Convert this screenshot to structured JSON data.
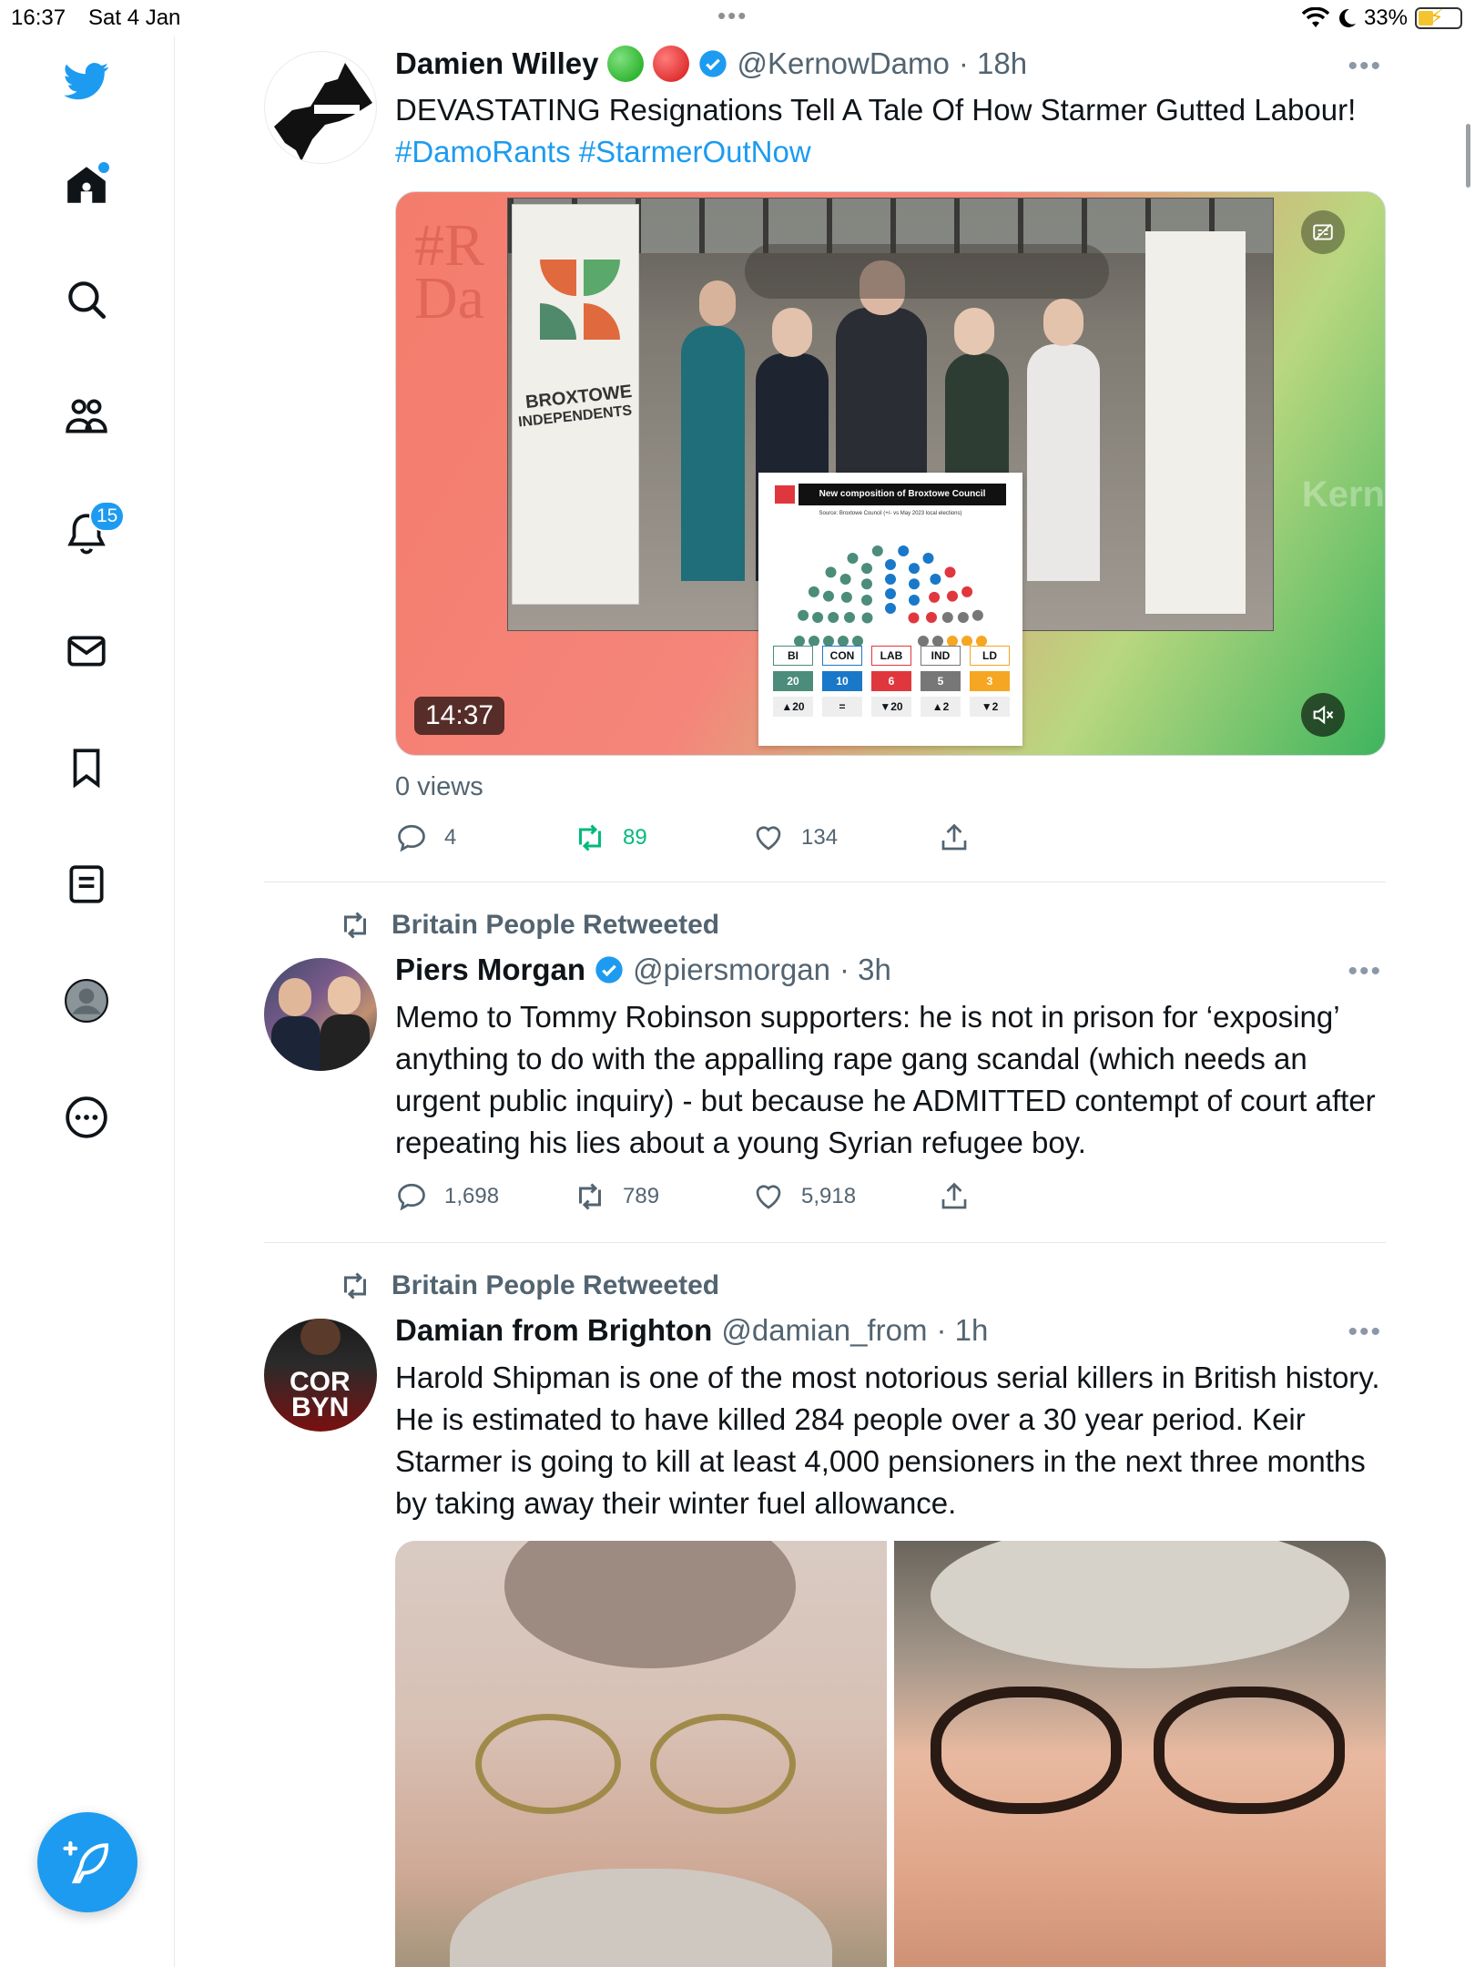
{
  "status_bar": {
    "time": "16:37",
    "date": "Sat 4 Jan",
    "battery": "33%"
  },
  "sidebar": {
    "notifications_count": "15"
  },
  "tweets": [
    {
      "name": "Damien Willey",
      "handle": "@KernowDamo",
      "time": "· 18h",
      "text_plain": "DEVASTATING Resignations Tell A Tale Of How Starmer Gutted Labour! ",
      "hashtag1": "#DamoRants",
      "hashtag2": "#StarmerOutNow",
      "video_duration": "14:37",
      "views": "0 views",
      "replies": "4",
      "retweets": "89",
      "likes": "134",
      "media": {
        "banner_line1": "BROXTOWE",
        "banner_line2": "INDEPENDENTS",
        "bg_text": "#R Da",
        "bg_text2": "Kern",
        "chart_title": "New composition of Broxtowe Council",
        "chart_source": "Source: Broxtowe Council (+/- vs May 2023 local elections)",
        "parties": [
          "BI",
          "CON",
          "LAB",
          "IND",
          "LD"
        ],
        "seats": [
          "20",
          "10",
          "6",
          "5",
          "3"
        ],
        "changes": [
          "▲20",
          "=",
          "▼20",
          "▲2",
          "▼2"
        ],
        "party_colors": [
          "#4c8c7a",
          "#1a78c8",
          "#e0373e",
          "#777777",
          "#f5a623"
        ]
      }
    },
    {
      "retweeted_by": "Britain People Retweeted",
      "name": "Piers Morgan",
      "handle": "@piersmorgan",
      "time": "· 3h",
      "text": "Memo to Tommy Robinson supporters: he is not in prison for ‘exposing’ anything to do with the appalling rape gang scandal (which needs an urgent public inquiry) - but because he ADMITTED  contempt of court after repeating his lies about a young Syrian refugee boy.",
      "replies": "1,698",
      "retweets": "789",
      "likes": "5,918"
    },
    {
      "retweeted_by": "Britain People Retweeted",
      "name": "Damian from Brighton",
      "handle": "@damian_from",
      "time": "· 1h",
      "text": "Harold Shipman is one of the most notorious serial killers in British history. He is estimated to have killed 284 people over a 30 year period. Keir Starmer is going to kill at least 4,000 pensioners in the next three months by taking away their winter fuel allowance.",
      "avatar_text1": "COR",
      "avatar_text2": "BYN"
    }
  ],
  "colors": {
    "accent": "#1d9bf0",
    "retweet_green": "#00ba7c",
    "secondary_text": "#536471"
  }
}
